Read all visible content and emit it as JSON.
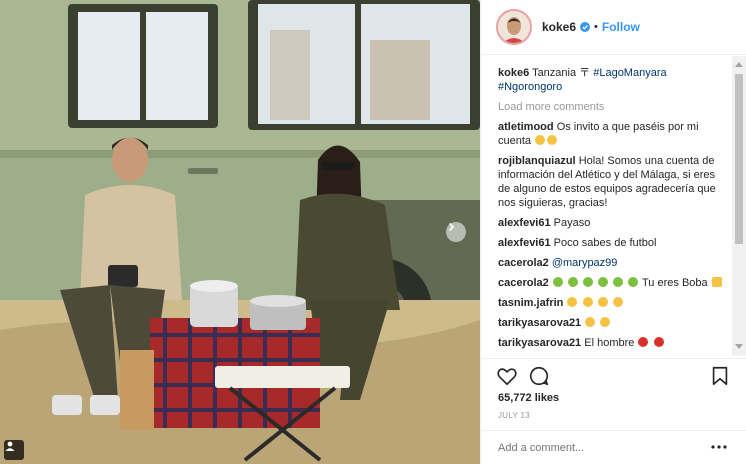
{
  "post": {
    "username": "koke6",
    "follow_label": "Follow",
    "separator": "•",
    "caption_user": "koke6",
    "caption_text": "Tanzania 〒 ",
    "caption_tags": [
      "#LagoManyara",
      "#Ngorongoro"
    ],
    "load_more": "Load more comments",
    "likes": "65,772 likes",
    "date": "JULY 13",
    "add_comment_placeholder": "Add a comment..."
  },
  "comments": [
    {
      "user": "atletimood",
      "text": "Os invito a que paséis por mi cuenta",
      "emojis": [
        "pray",
        "grimace"
      ]
    },
    {
      "user": "rojiblanquiazul",
      "text": "Hola! Somos una cuenta de información del Atlético y del Málaga, si eres de alguno de estos equipos agradecería que nos siguieras, gracias!",
      "emojis": []
    },
    {
      "user": "alexfevi61",
      "text": "Payaso",
      "emojis": []
    },
    {
      "user": "alexfevi61",
      "text": "Poco sabes de futbol",
      "emojis": []
    },
    {
      "user": "cacerola2",
      "text": "@marypaz99",
      "emojis": []
    },
    {
      "user": "cacerola2",
      "text": "Tu eres Boba",
      "emojis": [
        "angry",
        "angry",
        "angry",
        "angry",
        "angry",
        "angry",
        "fist"
      ]
    },
    {
      "user": "tasnim.jafrin",
      "text": "",
      "emojis": [
        "wink",
        "wink",
        "wink",
        "wink"
      ]
    },
    {
      "user": "tarikyasarova21",
      "text": "",
      "emojis": [
        "grin",
        "frown"
      ]
    },
    {
      "user": "tarikyasarova21",
      "text": "El hombre",
      "emojis": [
        "devil",
        "devil"
      ]
    }
  ],
  "icons": {
    "like": "heart-icon",
    "comment": "comment-bubble-icon",
    "save": "bookmark-icon",
    "more": "more-options-icon",
    "verified": "verified-badge-icon",
    "carousel": "person-tag-icon",
    "next": "chevron-right-icon"
  },
  "colors": {
    "link": "#3897f0",
    "hashtag": "#003569",
    "muted": "#999999",
    "text": "#262626",
    "divider": "#efefef"
  }
}
